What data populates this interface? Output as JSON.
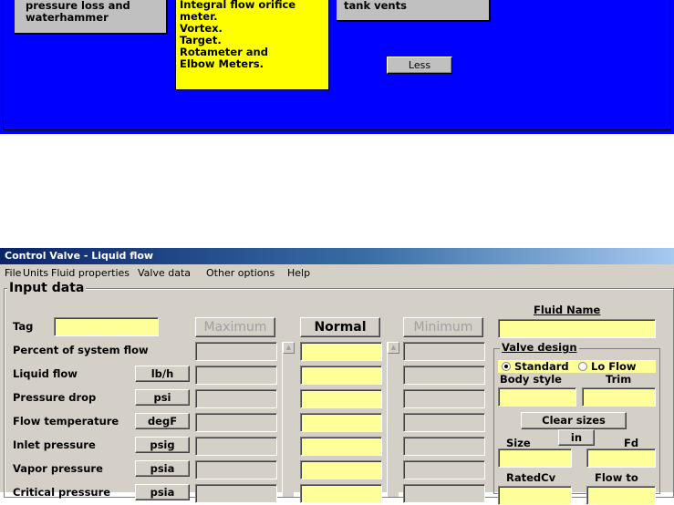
{
  "top_panel": {
    "card_left": [
      "pressure loss and",
      "waterhammer"
    ],
    "card_middle": [
      "Integral flow orifice",
      "meter.",
      "Vortex.",
      "Target.",
      "Rotameter and",
      "Elbow Meters."
    ],
    "card_right": [
      "tank vents"
    ],
    "less_button": "Less",
    "colors": {
      "background": "#0000ff",
      "highlight": "#ffff00",
      "card": "#c0c0c0"
    }
  },
  "window": {
    "title": "Control Valve  - Liquid flow",
    "menu": [
      {
        "label": "File"
      },
      {
        "label": "Units"
      },
      {
        "label": "Fluid properties"
      },
      {
        "label": "Valve data"
      },
      {
        "label": "Other options"
      },
      {
        "label": "Help"
      }
    ],
    "input_group_title": "Input data",
    "tag_label": "Tag",
    "tag_value": "",
    "column_buttons": {
      "maximum": "Maximum",
      "normal": "Normal",
      "minimum": "Minimum"
    },
    "rows": [
      {
        "label": "Percent of system flow",
        "unit": ""
      },
      {
        "label": "Liquid flow",
        "unit": "lb/h"
      },
      {
        "label": "Pressure drop",
        "unit": "psi"
      },
      {
        "label": "Flow temperature",
        "unit": "degF"
      },
      {
        "label": "Inlet pressure",
        "unit": "psig"
      },
      {
        "label": "Vapor pressure",
        "unit": "psia"
      },
      {
        "label": "Critical pressure",
        "unit": "psia"
      }
    ],
    "fluid_name_label": "Fluid Name",
    "fluid_name_value": "",
    "valve_design": {
      "title": "Valve design",
      "options": [
        "Standard",
        "Lo Flow"
      ],
      "selected": "Standard",
      "body_style_label": "Body style",
      "trim_label": "Trim",
      "clear_sizes": "Clear sizes",
      "size_label": "Size",
      "size_unit": "in",
      "fd_label": "Fd",
      "rated_cv_label": "RatedCv",
      "flow_to_label": "Flow to"
    },
    "colors": {
      "input": "#ffff99",
      "face": "#d4d0c8",
      "title_start": "#0a246a",
      "title_end": "#a6caf0"
    }
  }
}
